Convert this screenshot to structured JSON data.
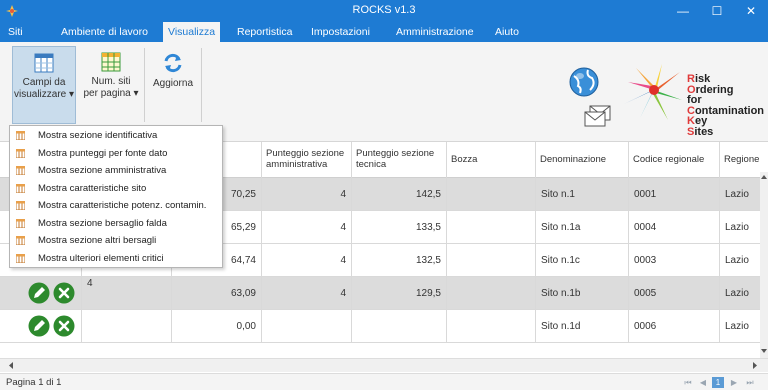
{
  "window": {
    "title": "ROCKS   v1.3",
    "minimize": "—",
    "maximize": "☐",
    "close": "✕"
  },
  "menu": {
    "items": [
      "Siti",
      "Ambiente di lavoro",
      "Visualizza",
      "Reportistica",
      "Impostazioni",
      "Amministrazione",
      "Aiuto"
    ],
    "active": "Visualizza"
  },
  "ribbon": {
    "campi_label_1": "Campi da",
    "campi_label_2": "visualizzare ▾",
    "num_label_1": "Num. siti",
    "num_label_2": "per pagina ▾",
    "aggiorna_label": "Aggiorna"
  },
  "logo": {
    "lines": [
      {
        "cap": "R",
        "rest": "isk"
      },
      {
        "cap": "O",
        "rest": "rdering"
      },
      {
        "cap": "",
        "rest": "for"
      },
      {
        "cap": "C",
        "rest": "ontamination"
      },
      {
        "cap": "K",
        "rest": "ey"
      },
      {
        "cap": "S",
        "rest": "ites"
      }
    ]
  },
  "dropdown": {
    "items": [
      "Mostra sezione identificativa",
      "Mostra punteggi per fonte dato",
      "Mostra sezione amministrativa",
      "Mostra caratteristiche sito",
      "Mostra caratteristiche potenz. contamin.",
      "Mostra sezione bersaglio falda",
      "Mostra sezione altri bersagli",
      "Mostra ulteriori elementi critici"
    ]
  },
  "table": {
    "columns": [
      "Punteggio sezione amministrativa",
      "Punteggio sezione tecnica",
      "Bozza",
      "Denominazione",
      "Codice regionale",
      "Regione"
    ],
    "rows": [
      {
        "index": "",
        "score": "70,25",
        "amm": "4",
        "tec": "142,5",
        "bozza": "",
        "den": "Sito n.1",
        "cod": "0001",
        "reg": "Lazio"
      },
      {
        "index": "",
        "score": "65,29",
        "amm": "4",
        "tec": "133,5",
        "bozza": "",
        "den": "Sito n.1a",
        "cod": "0004",
        "reg": "Lazio"
      },
      {
        "index": "",
        "score": "64,74",
        "amm": "4",
        "tec": "132,5",
        "bozza": "",
        "den": "Sito n.1c",
        "cod": "0003",
        "reg": "Lazio"
      },
      {
        "index": "4",
        "score": "63,09",
        "amm": "4",
        "tec": "129,5",
        "bozza": "",
        "den": "Sito n.1b",
        "cod": "0005",
        "reg": "Lazio"
      },
      {
        "index": "",
        "score": "0,00",
        "amm": "",
        "tec": "",
        "bozza": "",
        "den": "Sito n.1d",
        "cod": "0006",
        "reg": "Lazio"
      }
    ]
  },
  "status": {
    "page_text": "Pagina 1 di 1",
    "current_page": "1"
  },
  "colors": {
    "titlebar": "#1e7bd3",
    "edit_icon": "#2d8a2d",
    "delete_icon": "#2d8a2d"
  }
}
